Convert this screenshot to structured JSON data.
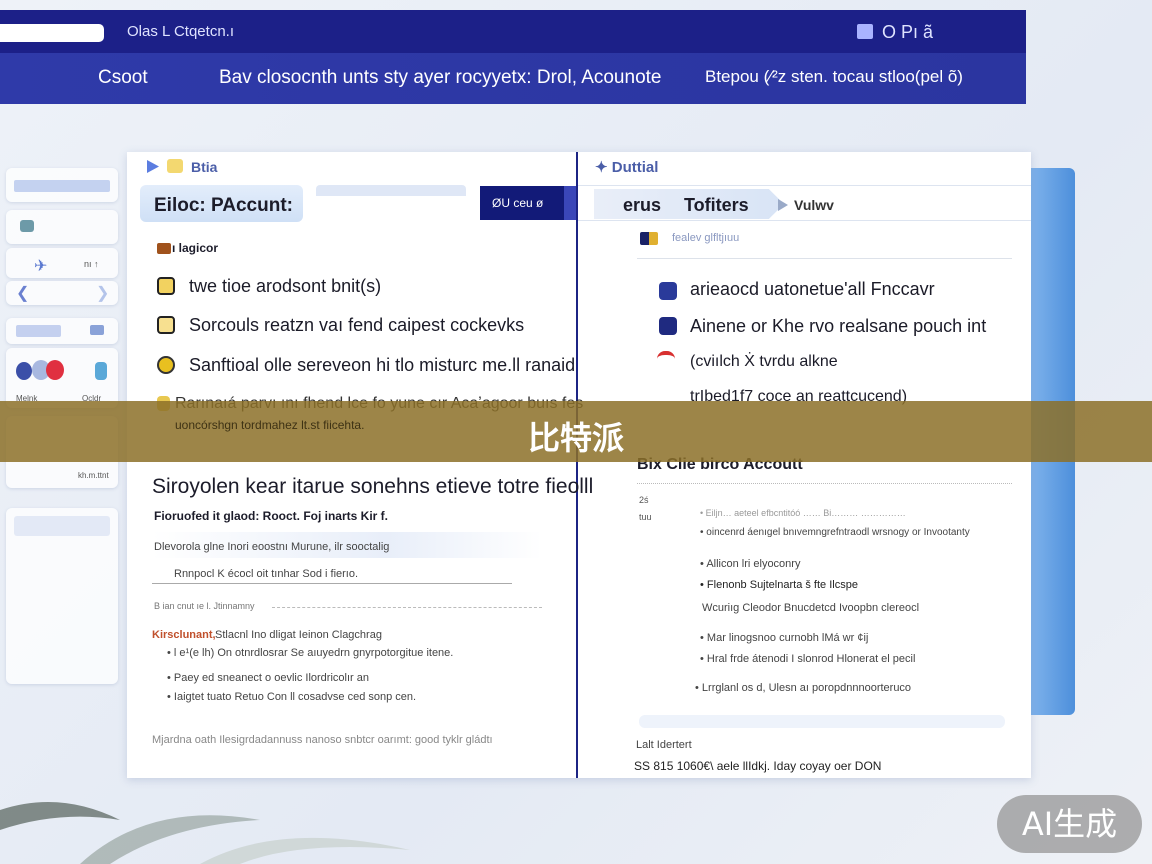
{
  "topbar": {
    "title": "Olas L Ctqetcn.ı",
    "right_label": "O Pı ã",
    "search_value": ""
  },
  "nav": {
    "items": [
      "Csoot",
      "Bav closocnth unts sty ayer rocyyetx: Drol, Acounote",
      "Btepou (∕²z sten. tocau stloo(pel õ)"
    ]
  },
  "sidebar": {
    "labels": [
      "nı ↑",
      "Melnk",
      "Ocldr",
      "kh.m.ttnt"
    ]
  },
  "left": {
    "header": "Btia",
    "account_label": "Eiloc: PAccunt:",
    "input_value": "",
    "button": "ØU ceu ø",
    "section_label": "ı lagicor",
    "items": [
      "twe tioe arodsont bnit(s)",
      "Sorcouls reatzn vaı fend caipest cockevks",
      "Sanftioal olle sereveon hi tlo misturc me.ll ranaid"
    ],
    "note1": "Rarınaıá parvı ını fhend lce fo yune cır Acaʼagoor buıs fes",
    "note2": "uoncórshgn tordmahez lt.st fiicehta.",
    "heading": "Siroyolen kear itarue sonehns etieve totre fieolll",
    "sub": "Fioruofed it glaod: Rooct. Foj inarts Kir f.",
    "line1": "Dlevorola glne Inori eoostnı Murune, ilr sooctalig",
    "line2": "Rnnpocl K écocl oit tınhar Sod i fierıo.",
    "line3": "B ian cnut ıe l. Jtinnamny",
    "red_label": "Kirsclunant,",
    "red_rest": "Stlacnl Ino dligat Ieinon Clagchrag",
    "bullets": [
      "l e¹(e lh) On otnrdlosrar Se aıuyedrn gnyrpotorgitue itene.",
      "Paey ed sneanect o oevlic Ilordricolır an",
      "Iaigtet tuato Retuo Con ll cosadvse ced sonp cen."
    ],
    "footer": "Mjardna oath Ilesigrdadannuss nanoso snbtcr oarımt: good tyklr gládtı"
  },
  "right": {
    "header": "Duttial",
    "tabs": [
      "erus",
      "Tofiters",
      "Vulwv"
    ],
    "sub_label": "fealev glfltjıuu",
    "items": [
      "arieaocd uatonetue'all Fnccavr",
      "Ainene or Khe rvo realsane pouch int",
      "(cviılch Ẋ tvrdu alkne",
      "trIbed1f7 coce an reattcucend)"
    ],
    "heading": "Bix Clie birco Accoutt",
    "side_labels": [
      "2ś",
      "tuu"
    ],
    "bullets": [
      "Eiljn… aeteel efbcntitóó …… Bi……… ……………",
      "oincenrd áenıgel bnıvemngrefntraodl wrsnogy or Invootanty",
      "Allicon lri elyoconry",
      "Flenonb Sujtelnarta š fte Ilcspe",
      "Wcuriıg Cleodor Bnucdetcd Ivoopbn clereocl",
      "Mar linogsnoo curnobh lMá wr ¢ĳ",
      "Hral frde átenodi I slonrod Hlonerat el pecil",
      "Lrrglanl os d, Ulesn aı poropdnnnoorteruco"
    ],
    "footer_label": "Lalt Idertert",
    "footer_value": "SS 815 1060€\\ aele llIdkj. Iday coyay oer DON"
  },
  "overlay": {
    "banner": "比特派",
    "badge": "AI生成"
  }
}
